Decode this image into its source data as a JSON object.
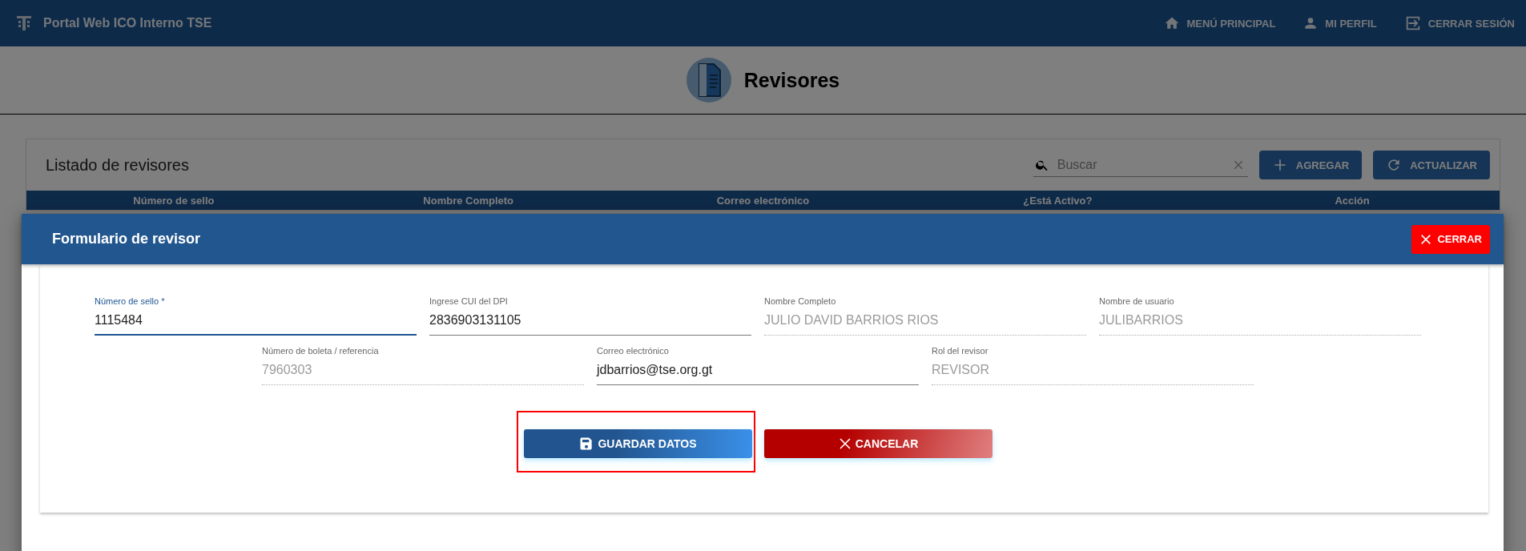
{
  "app_bar": {
    "title": "Portal Web ICO Interno TSE",
    "nav": [
      {
        "label": "MENÚ PRINCIPAL",
        "kind": "home"
      },
      {
        "label": "MI PERFIL",
        "kind": "person"
      },
      {
        "label": "CERRAR SESIÓN",
        "kind": "logout"
      }
    ]
  },
  "page_header": {
    "title": "Revisores"
  },
  "list_card": {
    "title": "Listado de revisores",
    "search": {
      "placeholder": "Buscar"
    },
    "buttons": [
      {
        "label": "AGREGAR",
        "kind": "add"
      },
      {
        "label": "ACTUALIZAR",
        "kind": "refresh"
      }
    ],
    "table": {
      "columns": [
        "Número de sello",
        "Nombre Completo",
        "Correo electrónico",
        "¿Está Activo?",
        "Acción"
      ]
    }
  },
  "dialog": {
    "title": "Formulario de revisor",
    "close_button": "CERRAR",
    "field_rows": [
      {
        "fields": [
          {
            "label": "Número de sello *",
            "value": "1115484",
            "focused": true,
            "disabled": false
          },
          {
            "label": "Ingrese CUI del DPI",
            "value": "2836903131105",
            "focused": false,
            "disabled": false
          },
          {
            "label": "Nombre Completo",
            "value": "JULIO DAVID BARRIOS RIOS",
            "focused": false,
            "disabled": true
          },
          {
            "label": "Nombre de usuario",
            "value": "JULIBARRIOS",
            "focused": false,
            "disabled": true
          }
        ]
      },
      {
        "fields": [
          {
            "label": "Número de boleta / referencia",
            "value": "7960303",
            "focused": false,
            "disabled": true
          },
          {
            "label": "Correo electrónico",
            "value": "jdbarrios@tse.org.gt",
            "focused": false,
            "disabled": false
          },
          {
            "label": "Rol del revisor",
            "value": "REVISOR",
            "focused": false,
            "disabled": true
          }
        ]
      }
    ],
    "buttons": [
      {
        "label": "GUARDAR DATOS",
        "kind": "save"
      },
      {
        "label": "CANCELAR",
        "kind": "cancel"
      }
    ]
  }
}
